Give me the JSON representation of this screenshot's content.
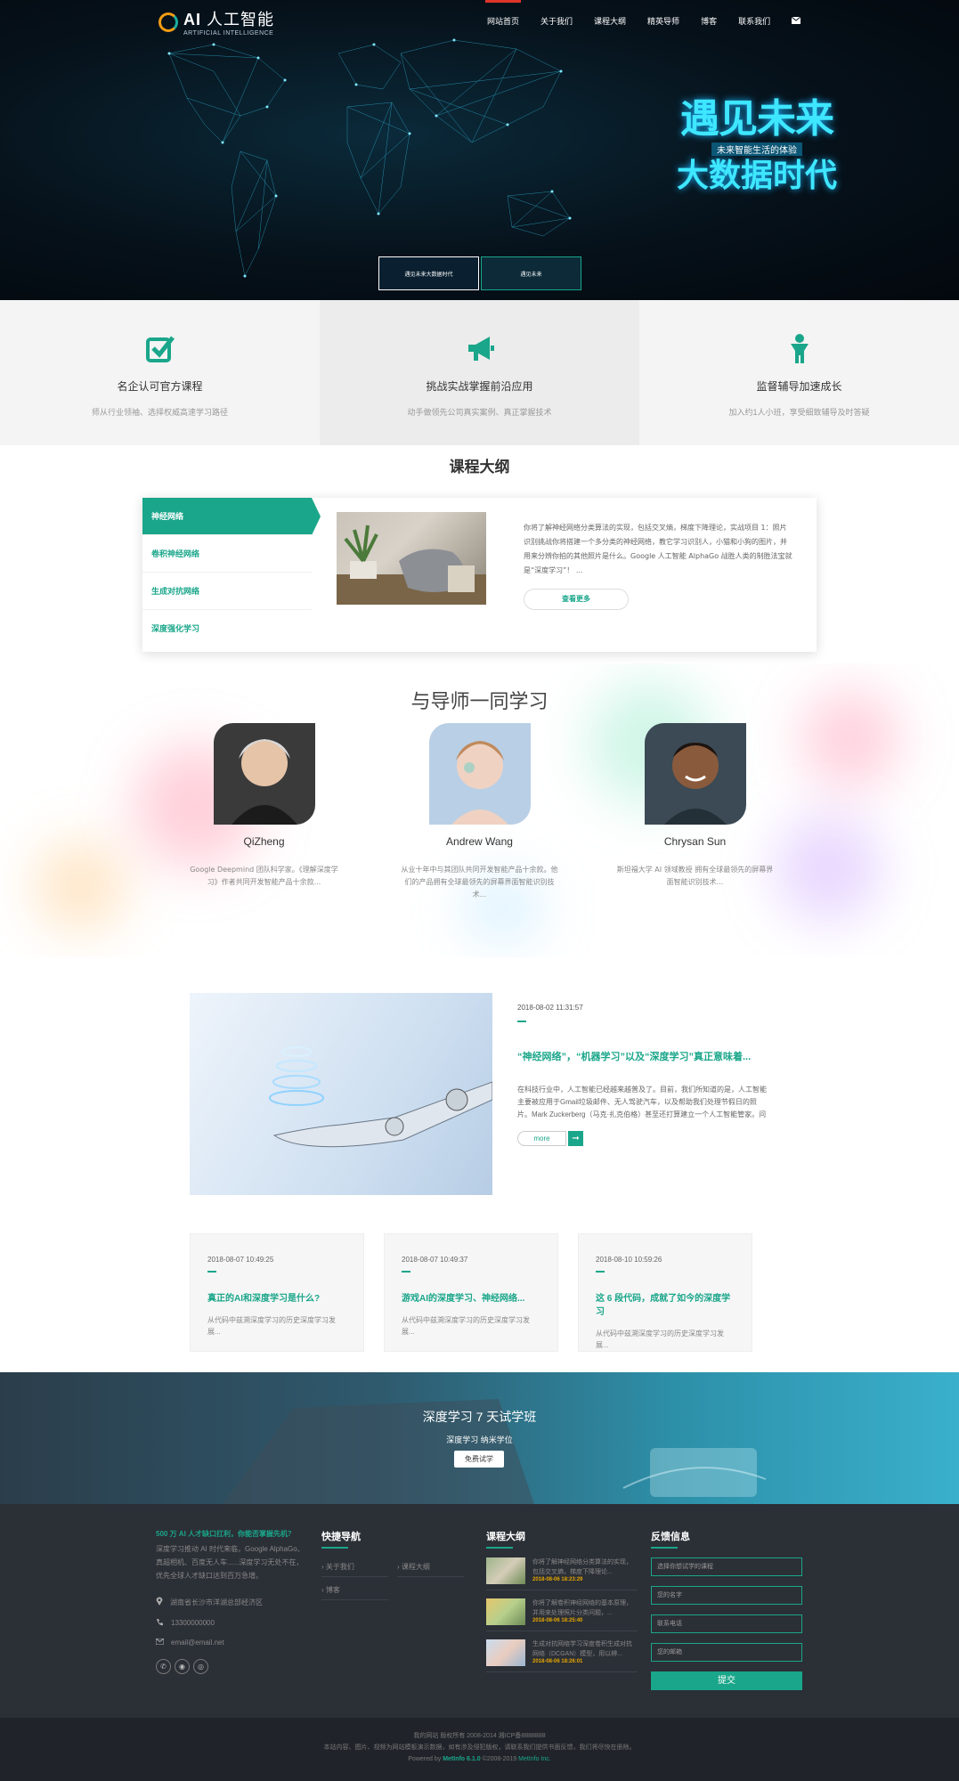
{
  "header": {
    "logo_main": "AI",
    "logo_cn": "人工智能",
    "logo_sub": "ARTIFICIAL INTELLIGENCE",
    "nav": [
      {
        "label": "网站首页",
        "active": true
      },
      {
        "label": "关于我们",
        "active": false
      },
      {
        "label": "课程大纲",
        "active": false
      },
      {
        "label": "精英导师",
        "active": false
      },
      {
        "label": "博客",
        "active": false
      },
      {
        "label": "联系我们",
        "active": false
      }
    ],
    "mail_icon": "envelope-icon"
  },
  "hero": {
    "slogan_top": "遇见未来",
    "slogan_mid": "未来智能生活的体验",
    "slogan_bottom": "大数据时代",
    "thumbs": [
      "遇见未来大数据时代",
      "遇见未来"
    ]
  },
  "features": [
    {
      "icon": "check-square-icon",
      "title": "名企认可官方课程",
      "text": "师从行业领袖、选择权威高速学习路径"
    },
    {
      "icon": "bullhorn-icon",
      "title": "挑战实战掌握前沿应用",
      "text": "动手做领先公司真实案例、真正掌握技术"
    },
    {
      "icon": "child-icon",
      "title": "监督辅导加速成长",
      "text": "加入约1人小班，享受细致辅导及时答疑"
    }
  ],
  "course": {
    "title": "课程大纲",
    "tabs": [
      "神经网络",
      "卷积神经网络",
      "生成对抗网络",
      "深度强化学习"
    ],
    "text": "你将了解神经网络分类算法的实现，包括交叉熵，梯度下降理论，实战项目 1：照片识别挑战你将搭建一个多分类的神经网络，教它学习识别人，小猫和小狗的图片，并用来分辨你拍的其他照片是什么。Google 人工智能 AlphaGo 战胜人类的制胜法宝就是“深度学习”！ ...",
    "more": "查看更多"
  },
  "mentors": {
    "title": "与导师一同学习",
    "items": [
      {
        "name": "QiZheng",
        "desc": "Google Deepmind 团队科学家。《理解深度学习》作者共同开发智能产品十余款..."
      },
      {
        "name": "Andrew Wang",
        "desc": "从业十年中与其团队共同开发智能产品十余款。他们的产品拥有全球最领先的屏幕界面智能识别技术..."
      },
      {
        "name": "Chrysan Sun",
        "desc": "斯坦福大学 AI 领域教授 拥有全球最领先的屏幕界面智能识别技术..."
      }
    ]
  },
  "news": {
    "featured": {
      "date": "2018-08-02 11:31:57",
      "title": "“神经网络”，“机器学习”以及“深度学习”真正意味着...",
      "text": "在科技行业中，人工智能已经越来越普及了。目前，我们所知道的是，人工智能主要被应用于Gmail垃圾邮件、无人驾驶汽车，以及帮助我们处理节假日的照片。Mark Zuckerberg（马克·扎克伯格）甚至还打算建立一个人工智能管家。问",
      "more": "more"
    },
    "cards": [
      {
        "date": "2018-08-07 10:49:25",
        "title": "真正的AI和深度学习是什么?",
        "text": "从代码中兹溯深度学习的历史深度学习发展..."
      },
      {
        "date": "2018-08-07 10:49:37",
        "title": "游戏AI的深度学习、神经网络...",
        "text": "从代码中兹溯深度学习的历史深度学习发展..."
      },
      {
        "date": "2018-08-10 10:59:26",
        "title": "这 6 段代码，成就了如今的深度学习",
        "text": "从代码中兹溯深度学习的历史深度学习发展..."
      }
    ]
  },
  "cta": {
    "title": "深度学习 7 天试学班",
    "subtitle": "深度学习 纳米学位",
    "button": "免费试学"
  },
  "footer": {
    "about_highlight": "500 万 AI 人才缺口扛利，你能否掌握先机？",
    "about_text": "深度学习推动 AI 时代来临，Google AlphaGo、真超相机、百度无人车......深度学习无处不在，优先全球人才缺口达到百万急增。",
    "address": "湖南省长沙市洋湖总部经济区",
    "phone": "13300000000",
    "email": "email@email.net",
    "social_icons": [
      "wechat-icon",
      "qq-icon",
      "weibo-icon"
    ],
    "quicknav_title": "快捷导航",
    "quicknav": [
      "关于我们",
      "课程大纲",
      "博客"
    ],
    "course_title": "课程大纲",
    "course_items": [
      {
        "text": "你将了解神经网络分类算法的实现，包括交叉熵，梯度下降理论...",
        "date": "2018-08-06 18:23:29"
      },
      {
        "text": "你将了解卷积神经网络的基本原理，并用来处理照片分类问题，...",
        "date": "2018-08-06 18:25:40"
      },
      {
        "text": "生成对抗网络学习深度卷积生成对抗网络（DCGAN）模型，用以辨...",
        "date": "2018-08-06 18:26:01"
      }
    ],
    "feedback_title": "反馈信息",
    "feedback_fields": [
      "选择你想试学的课程",
      "您的名字",
      "联系电话",
      "您的邮箱"
    ],
    "submit": "提交"
  },
  "copyright": {
    "line1": "我的网站 版权所有 2008-2014 湘ICP备8888888",
    "line2": "本站内容、图片、视频为网站模板演示数据，如有涉及侵犯版权，请联系我们提供书面反馈，我们将尽快在册除。",
    "powered_pre": "Powered by",
    "powered_name": "MetInfo 6.1.0",
    "powered_post": "©2008-2019",
    "powered_link": "MetInfo Inc."
  }
}
